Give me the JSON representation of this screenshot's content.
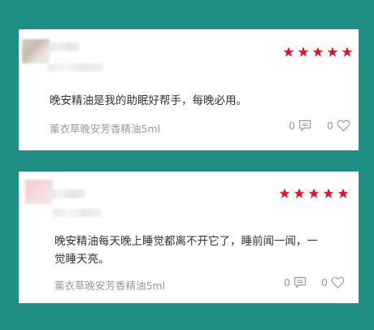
{
  "reviews": [
    {
      "rating": 5,
      "text": "晚安精油是我的助眠好帮手，每晚必用。",
      "product": "薰衣草晚安芳香精油5ml",
      "comment_count": "0",
      "like_count": "0"
    },
    {
      "rating": 5,
      "text_line1": "晚安精油每天晚上睡觉都离不开它了，睡前闻一闻，一",
      "text_line2": "觉睡天亮。",
      "product": "薰衣草晚安芳香精油5ml",
      "comment_count": "0",
      "like_count": "0"
    }
  ],
  "colors": {
    "background": "#1f8f85",
    "star": "#e60f2d"
  },
  "icons": [
    "star-icon",
    "comment-icon",
    "heart-icon"
  ]
}
